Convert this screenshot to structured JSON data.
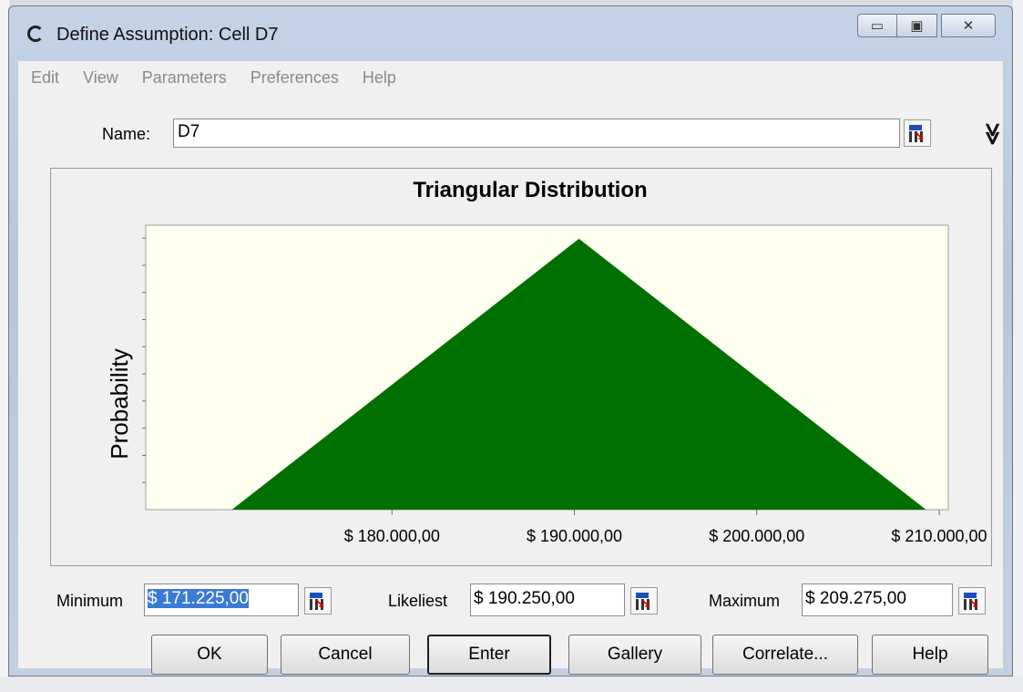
{
  "window": {
    "title": "Define Assumption: Cell D7",
    "minimize_glyph": "▭",
    "maximize_glyph": "▣",
    "close_glyph": "✕"
  },
  "menu": [
    "Edit",
    "View",
    "Parameters",
    "Preferences",
    "Help"
  ],
  "name_field": {
    "label": "Name:",
    "value": "D7"
  },
  "expand_glyph": "≫",
  "parameters": {
    "minimum": {
      "label": "Minimum",
      "value": "$ 171.225,00"
    },
    "likeliest": {
      "label": "Likeliest",
      "value": "$ 190.250,00"
    },
    "maximum": {
      "label": "Maximum",
      "value": "$ 209.275,00"
    }
  },
  "buttons": {
    "ok": "OK",
    "cancel": "Cancel",
    "enter": "Enter",
    "gallery": "Gallery",
    "correlate": "Correlate...",
    "help": "Help"
  },
  "colors": {
    "fill": "#007000",
    "plot_bg": "#fffff0"
  },
  "chart_data": {
    "type": "area",
    "title": "Triangular Distribution",
    "ylabel": "Probability",
    "xlabel": "",
    "x": [
      171225,
      190250,
      209275
    ],
    "y": [
      0,
      1,
      0
    ],
    "xlim": [
      166500,
      210500
    ],
    "ylim": [
      0,
      1.05
    ],
    "x_ticks": [
      180000,
      190000,
      200000,
      210000
    ],
    "x_tick_labels": [
      "$ 180.000,00",
      "$ 190.000,00",
      "$ 200.000,00",
      "$ 210.000,00"
    ],
    "y_tick_count": 11,
    "grid": false
  }
}
